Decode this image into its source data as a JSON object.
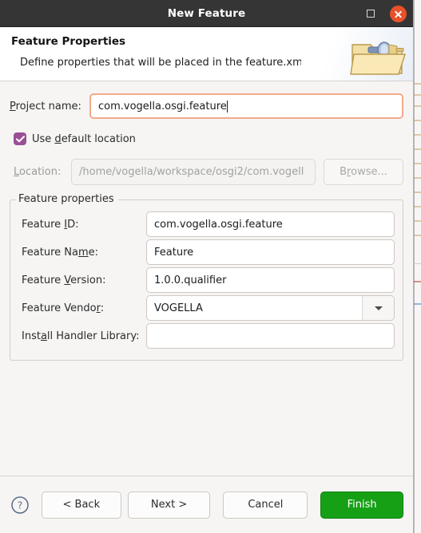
{
  "window": {
    "title": "New Feature",
    "maximize_icon": "maximize-icon",
    "close_icon": "close-icon"
  },
  "banner": {
    "title": "Feature Properties",
    "description": "Define properties that will be placed in the feature.xml file",
    "icon": "feature-project-folder-icon"
  },
  "form": {
    "project_name": {
      "label": "Project name:",
      "mnemonic": "P",
      "label_rest": "roject name:",
      "value": "com.vogella.osgi.feature",
      "focused": true
    },
    "use_default_location": {
      "label_pre": "Use ",
      "mnemonic": "d",
      "label_post": "efault location",
      "checked": true
    },
    "location": {
      "label_mnemonic": "L",
      "label_rest": "ocation:",
      "value": "/home/vogella/workspace/osgi2/com.vogell",
      "enabled": false
    },
    "browse": {
      "label_pre": "B",
      "mnemonic": "r",
      "label_post": "owse...",
      "enabled": false
    }
  },
  "group": {
    "legend": "Feature properties",
    "fields": [
      {
        "label_pre": "Feature ",
        "mnemonic": "I",
        "label_post": "D:",
        "value": "com.vogella.osgi.feature",
        "type": "text"
      },
      {
        "label_pre": "Feature Na",
        "mnemonic": "m",
        "label_post": "e:",
        "value": "Feature",
        "type": "text"
      },
      {
        "label_pre": "Feature ",
        "mnemonic": "V",
        "label_post": "ersion:",
        "value": "1.0.0.qualifier",
        "type": "text"
      },
      {
        "label_pre": "Feature Vendo",
        "mnemonic": "r",
        "label_post": ":",
        "value": "VOGELLA",
        "type": "combo"
      },
      {
        "label_pre": "Inst",
        "mnemonic": "a",
        "label_post": "ll Handler Library:",
        "value": "",
        "type": "text"
      }
    ]
  },
  "footer": {
    "help_icon": "help-circle-icon",
    "back": "< Back",
    "next": "Next >",
    "cancel": "Cancel",
    "finish": "Finish"
  },
  "colors": {
    "titlebar_bg": "#353535",
    "close_button": "#e8512a",
    "checkbox_accent": "#9b4f96",
    "focus_border": "#f4a98b",
    "finish_button": "#16a016",
    "dialog_bg": "#f6f5f4"
  }
}
